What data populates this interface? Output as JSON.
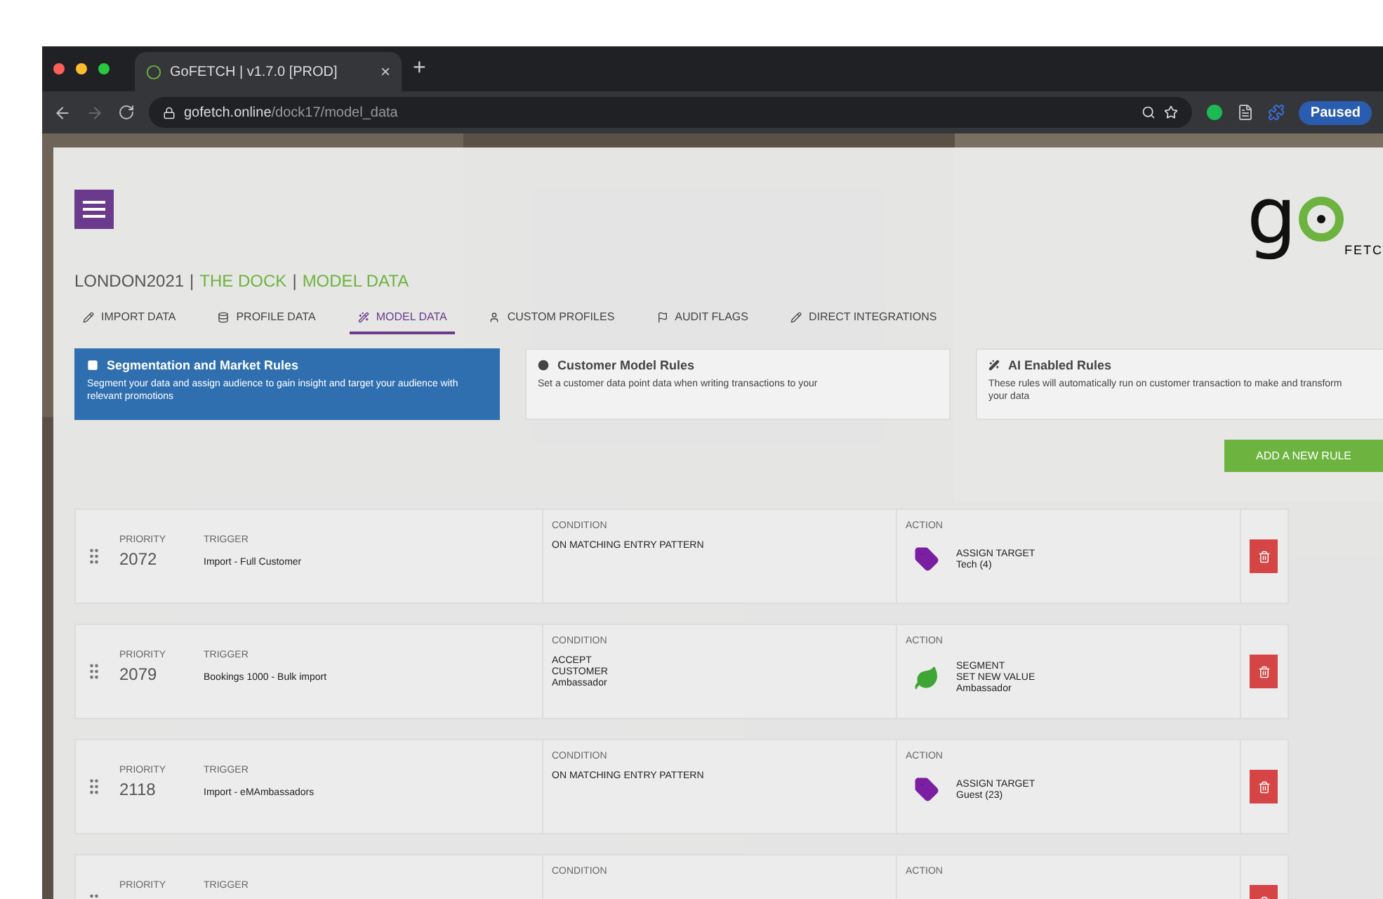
{
  "browser": {
    "tab_title": "GoFETCH | v1.7.0 [PROD]",
    "tab_close": "×",
    "new_tab": "+",
    "url_host": "gofetch.online",
    "url_path": "/dock17/model_data",
    "profile": "Paused"
  },
  "header": {
    "logo": {
      "letter": "g",
      "subtitle": "FETC"
    },
    "breadcrumb": [
      {
        "text": "LONDON2021",
        "highlight": false
      },
      {
        "text": "THE DOCK",
        "highlight": true
      },
      {
        "text": "MODEL DATA",
        "highlight": true
      }
    ],
    "separator": "|"
  },
  "nav": [
    {
      "label": "IMPORT DATA",
      "selected": false
    },
    {
      "label": "PROFILE DATA",
      "selected": false
    },
    {
      "label": "MODEL DATA",
      "selected": true
    },
    {
      "label": "CUSTOM PROFILES",
      "selected": false
    },
    {
      "label": "AUDIT FLAGS",
      "selected": false
    },
    {
      "label": "DIRECT INTEGRATIONS",
      "selected": false
    }
  ],
  "rule_types": [
    {
      "title": "Segmentation and Market Rules",
      "description": "Segment your data and assign audience to gain insight and target your audience with relevant promotions",
      "selected": true
    },
    {
      "title": "Customer Model Rules",
      "description": "Set a customer data point data when writing transactions to your",
      "selected": false
    },
    {
      "title": "AI Enabled Rules",
      "description": "These rules will automatically run on customer transaction to make and transform your data",
      "selected": false
    }
  ],
  "add_button": "ADD A NEW RULE",
  "rules": [
    {
      "priority_label": "PRIORITY",
      "priority": "2072",
      "trigger_label": "TRIGGER",
      "trigger": "Import - Full Customer",
      "condition_label": "CONDITION",
      "condition": [
        "ON MATCHING ENTRY PATTERN"
      ],
      "action_label": "ACTION",
      "action": {
        "kind": "tag",
        "lines": [
          "ASSIGN TARGET",
          "Tech (4)"
        ]
      }
    },
    {
      "priority_label": "PRIORITY",
      "priority": "2079",
      "trigger_label": "TRIGGER",
      "trigger": "Bookings 1000 - Bulk import",
      "condition_label": "CONDITION",
      "condition": [
        "ACCEPT",
        "CUSTOMER",
        "Ambassador"
      ],
      "action_label": "ACTION",
      "action": {
        "kind": "leaf",
        "lines": [
          "SEGMENT",
          "SET NEW VALUE",
          "Ambassador"
        ]
      }
    },
    {
      "priority_label": "PRIORITY",
      "priority": "2118",
      "trigger_label": "TRIGGER",
      "trigger": "Import - eMAmbassadors",
      "condition_label": "CONDITION",
      "condition": [
        "ON MATCHING ENTRY PATTERN"
      ],
      "action_label": "ACTION",
      "action": {
        "kind": "tag",
        "lines": [
          "ASSIGN TARGET",
          "Guest (23)"
        ]
      }
    },
    {
      "priority_label": "PRIORITY",
      "trigger_label": "TRIGGER",
      "condition_label": "CONDITION",
      "action_label": "ACTION"
    }
  ]
}
